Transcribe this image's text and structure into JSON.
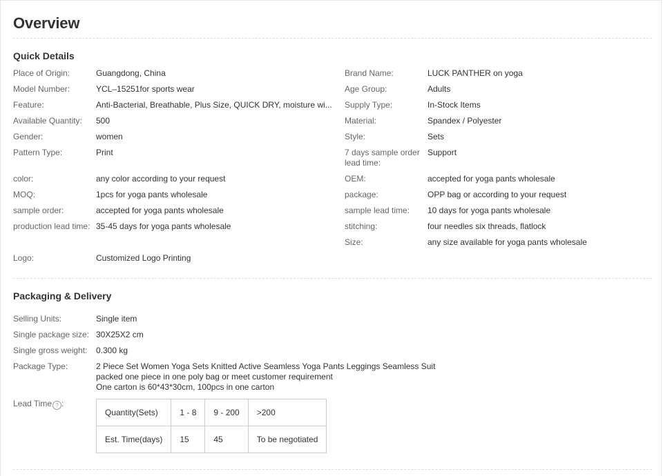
{
  "overview": {
    "title": "Overview"
  },
  "quick_details": {
    "title": "Quick Details",
    "left": [
      {
        "key": "Place of Origin:",
        "value": "Guangdong, China"
      },
      {
        "key": "Model Number:",
        "value": "YCL–15251for sports wear"
      },
      {
        "key": "Feature:",
        "value": "Anti-Bacterial, Breathable, Plus Size, QUICK DRY, moisture wi..."
      },
      {
        "key": "Available Quantity:",
        "value": "500"
      },
      {
        "key": "Gender:",
        "value": "women"
      },
      {
        "key": "Pattern Type:",
        "value": "Print"
      },
      {
        "key": "color:",
        "value": "any color according to your request"
      },
      {
        "key": "MOQ:",
        "value": "1pcs for yoga pants wholesale"
      },
      {
        "key": "sample order:",
        "value": "accepted for yoga pants wholesale"
      },
      {
        "key": "production lead time:",
        "value": "35-45 days for yoga pants wholesale"
      },
      {
        "key": "Logo:",
        "value": "Customized Logo Printing"
      }
    ],
    "right": [
      {
        "key": "Brand Name:",
        "value": "LUCK PANTHER on yoga"
      },
      {
        "key": "Age Group:",
        "value": "Adults"
      },
      {
        "key": "Supply Type:",
        "value": "In-Stock Items"
      },
      {
        "key": "Material:",
        "value": "Spandex / Polyester"
      },
      {
        "key": "Style:",
        "value": "Sets"
      },
      {
        "key": "7 days sample order lead time:",
        "value": "Support"
      },
      {
        "key": "OEM:",
        "value": "accepted for yoga pants wholesale"
      },
      {
        "key": "package:",
        "value": "OPP bag or according to your request"
      },
      {
        "key": "sample lead time:",
        "value": "10 days for yoga pants wholesale"
      },
      {
        "key": "stitching:",
        "value": "four needles six threads, flatlock"
      },
      {
        "key": "Size:",
        "value": "any size available for yoga pants wholesale"
      }
    ]
  },
  "packaging": {
    "title": "Packaging & Delivery",
    "rows": [
      {
        "key": "Selling Units:",
        "value": "Single item"
      },
      {
        "key": "Single package size:",
        "value": "30X25X2 cm"
      },
      {
        "key": "Single gross weight:",
        "value": "0.300 kg"
      },
      {
        "key": "Package Type:",
        "lines": [
          "2 Piece Set Women Yoga Sets Knitted Active Seamless Yoga Pants Leggings Seamless Suit",
          "packed one piece in one poly bag or meet customer requirement",
          "One carton is 60*43*30cm, 100pcs in one carton"
        ]
      }
    ],
    "lead_time": {
      "label": "Lead Time",
      "help_glyph": "?",
      "header": [
        "Quantity(Sets)",
        "1 - 8",
        "9 - 200",
        ">200"
      ],
      "row": [
        "Est. Time(days)",
        "15",
        "45",
        "To be negotiated"
      ]
    }
  }
}
